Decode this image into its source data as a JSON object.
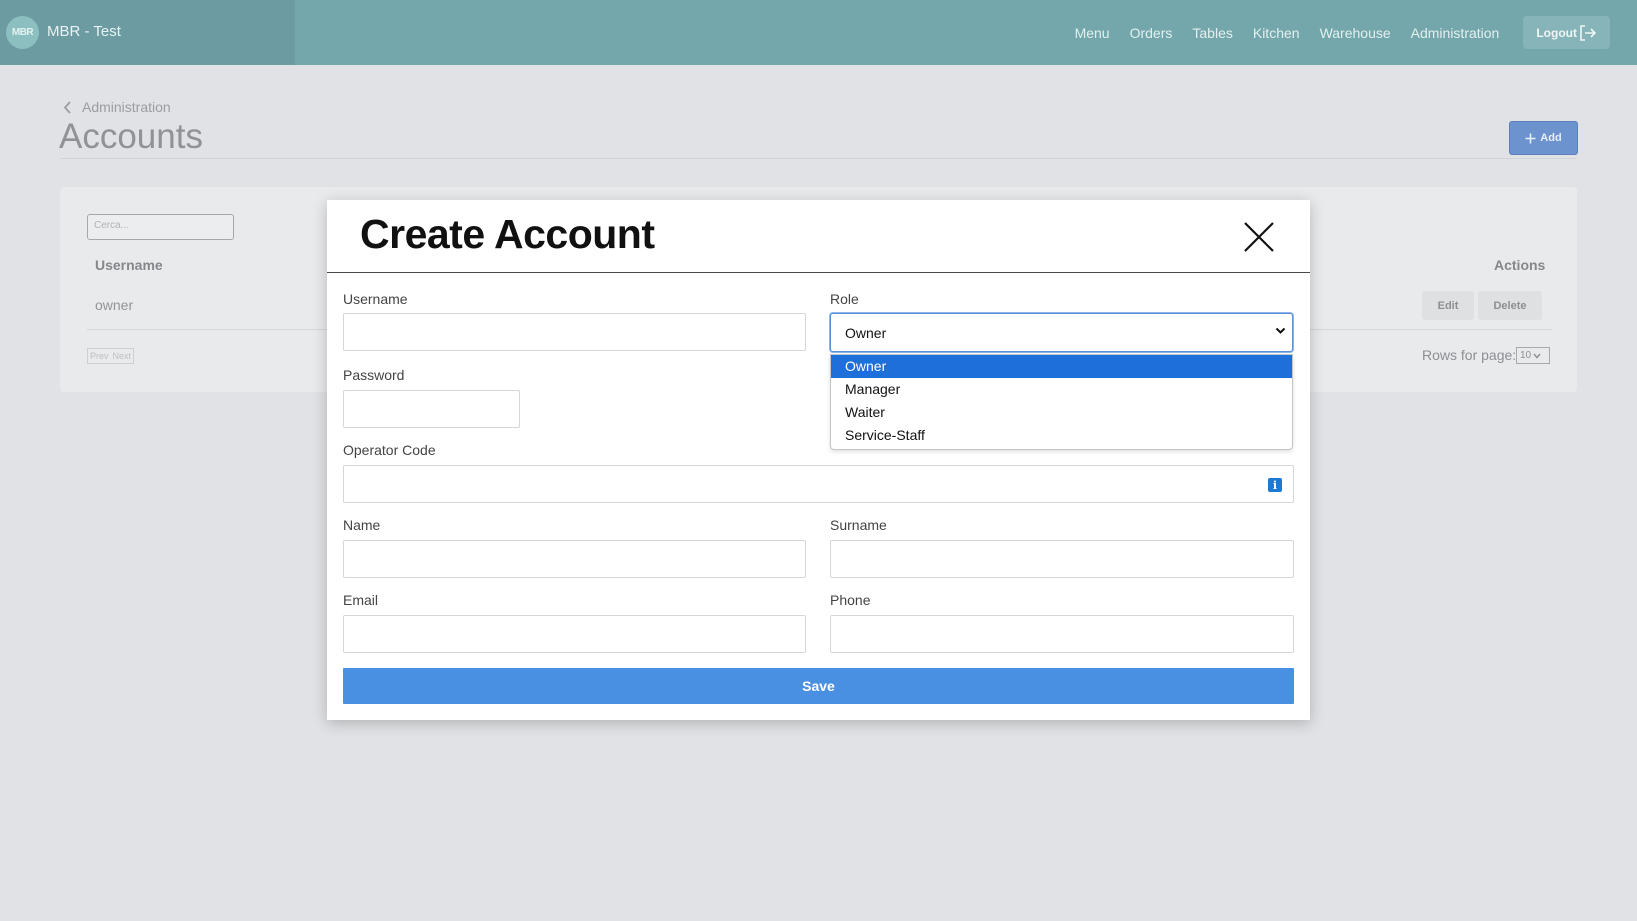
{
  "app": {
    "logo_text": "MBR",
    "title": "MBR - Test"
  },
  "nav": {
    "items": [
      {
        "label": "Menu"
      },
      {
        "label": "Orders"
      },
      {
        "label": "Tables"
      },
      {
        "label": "Kitchen"
      },
      {
        "label": "Warehouse"
      },
      {
        "label": "Administration"
      }
    ],
    "logout_label": "Logout"
  },
  "page": {
    "breadcrumb": "Administration",
    "title": "Accounts",
    "add_label": "Add"
  },
  "table": {
    "search_placeholder": "Cerca...",
    "columns": {
      "username": "Username",
      "actions": "Actions"
    },
    "rows": [
      {
        "username": "owner",
        "edit_label": "Edit",
        "delete_label": "Delete"
      }
    ],
    "pager": {
      "prev": "Prev",
      "next": "Next"
    },
    "rows_per_page_label": "Rows for page:",
    "rows_per_page_value": "10"
  },
  "modal": {
    "title": "Create Account",
    "fields": {
      "username": {
        "label": "Username",
        "value": ""
      },
      "role": {
        "label": "Role",
        "value": "Owner",
        "options": [
          "Owner",
          "Manager",
          "Waiter",
          "Service-Staff"
        ],
        "highlighted": "Owner"
      },
      "password": {
        "label": "Password",
        "value": ""
      },
      "operator_code": {
        "label": "Operator Code",
        "value": "",
        "info_icon": "i"
      },
      "name": {
        "label": "Name",
        "value": ""
      },
      "surname": {
        "label": "Surname",
        "value": ""
      },
      "email": {
        "label": "Email",
        "value": ""
      },
      "phone": {
        "label": "Phone",
        "value": ""
      }
    },
    "save_label": "Save"
  },
  "colors": {
    "topbar": "#74a7ab",
    "primary_button": "#4a90e2",
    "dropdown_highlight": "#1e6fd9",
    "info_icon": "#1f78d1"
  }
}
